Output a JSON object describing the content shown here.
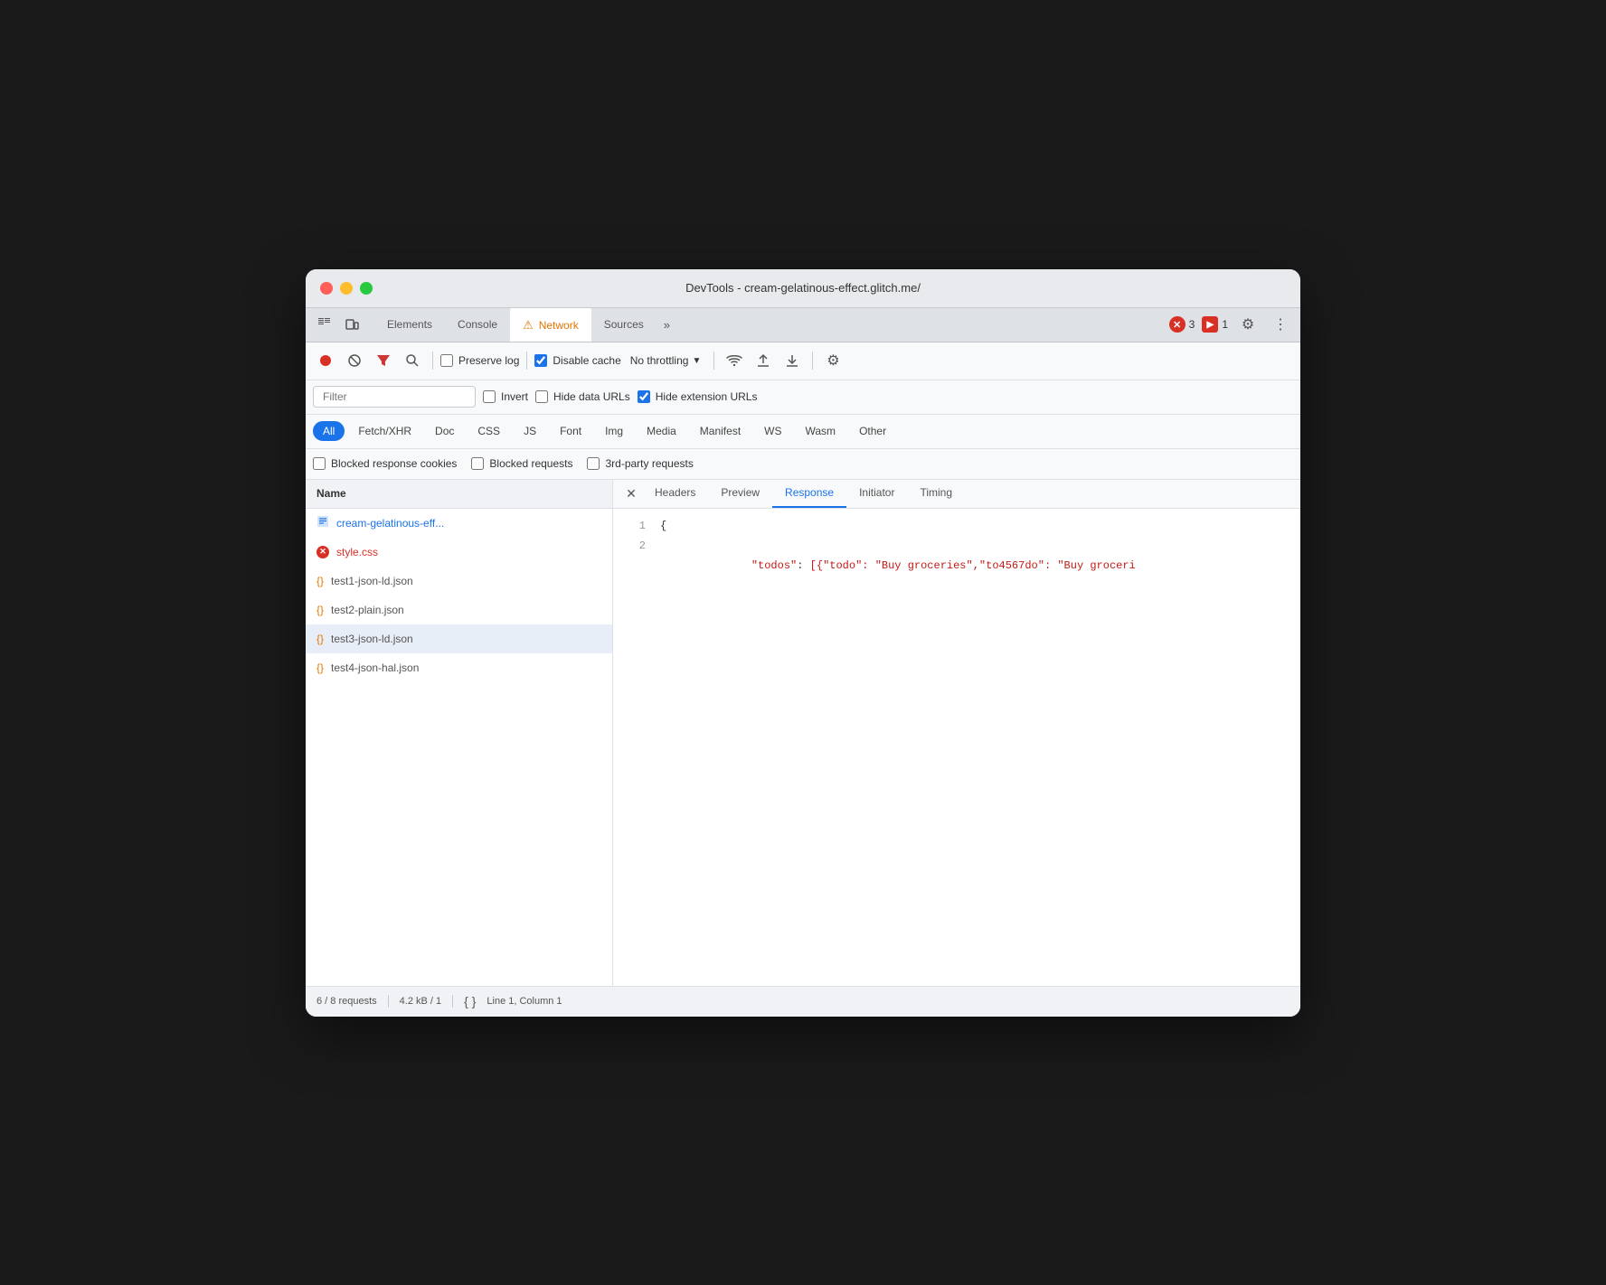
{
  "window": {
    "title": "DevTools - cream-gelatinous-effect.glitch.me/"
  },
  "tabs": {
    "items": [
      {
        "id": "elements",
        "label": "Elements",
        "active": false
      },
      {
        "id": "console",
        "label": "Console",
        "active": false
      },
      {
        "id": "network",
        "label": "Network",
        "active": true,
        "hasWarning": true
      },
      {
        "id": "sources",
        "label": "Sources",
        "active": false
      }
    ],
    "overflow_label": "»",
    "error_count": "3",
    "warn_count": "1"
  },
  "toolbar": {
    "record_title": "Stop recording network log",
    "clear_title": "Clear",
    "filter_title": "Filter",
    "search_title": "Search",
    "preserve_log_label": "Preserve log",
    "disable_cache_label": "Disable cache",
    "throttle_label": "No throttling",
    "wifi_title": "Online",
    "upload_title": "Import HAR file",
    "download_title": "Export HAR",
    "settings_title": "Network settings"
  },
  "filter": {
    "placeholder": "Filter",
    "invert_label": "Invert",
    "hide_data_label": "Hide data URLs",
    "hide_ext_label": "Hide extension URLs"
  },
  "type_filters": {
    "items": [
      {
        "id": "all",
        "label": "All",
        "active": true
      },
      {
        "id": "fetch",
        "label": "Fetch/XHR",
        "active": false
      },
      {
        "id": "doc",
        "label": "Doc",
        "active": false
      },
      {
        "id": "css",
        "label": "CSS",
        "active": false
      },
      {
        "id": "js",
        "label": "JS",
        "active": false
      },
      {
        "id": "font",
        "label": "Font",
        "active": false
      },
      {
        "id": "img",
        "label": "Img",
        "active": false
      },
      {
        "id": "media",
        "label": "Media",
        "active": false
      },
      {
        "id": "manifest",
        "label": "Manifest",
        "active": false
      },
      {
        "id": "ws",
        "label": "WS",
        "active": false
      },
      {
        "id": "wasm",
        "label": "Wasm",
        "active": false
      },
      {
        "id": "other",
        "label": "Other",
        "active": false
      }
    ]
  },
  "extra_filters": {
    "blocked_cookies_label": "Blocked response cookies",
    "blocked_requests_label": "Blocked requests",
    "third_party_label": "3rd-party requests"
  },
  "file_list": {
    "header": "Name",
    "items": [
      {
        "id": "main",
        "name": "cream-gelatinous-eff...",
        "icon": "doc",
        "selected": false
      },
      {
        "id": "style",
        "name": "style.css",
        "icon": "error",
        "selected": false
      },
      {
        "id": "test1",
        "name": "test1-json-ld.json",
        "icon": "json",
        "selected": false
      },
      {
        "id": "test2",
        "name": "test2-plain.json",
        "icon": "json",
        "selected": false
      },
      {
        "id": "test3",
        "name": "test3-json-ld.json",
        "icon": "json",
        "selected": true
      },
      {
        "id": "test4",
        "name": "test4-json-hal.json",
        "icon": "json",
        "selected": false
      }
    ]
  },
  "detail": {
    "tabs": [
      {
        "id": "headers",
        "label": "Headers",
        "active": false
      },
      {
        "id": "preview",
        "label": "Preview",
        "active": false
      },
      {
        "id": "response",
        "label": "Response",
        "active": true
      },
      {
        "id": "initiator",
        "label": "Initiator",
        "active": false
      },
      {
        "id": "timing",
        "label": "Timing",
        "active": false
      }
    ],
    "response": {
      "line1_num": "1",
      "line1_content": "{",
      "line2_num": "2",
      "line2_key": "\"todos\"",
      "line2_colon": ": ",
      "line2_val": "[{\"todo\": \"Buy groceries\",\"to4567do\": \"Buy groceri"
    }
  },
  "status_bar": {
    "requests": "6 / 8 requests",
    "size": "4.2 kB / 1",
    "position": "Line 1, Column 1"
  }
}
